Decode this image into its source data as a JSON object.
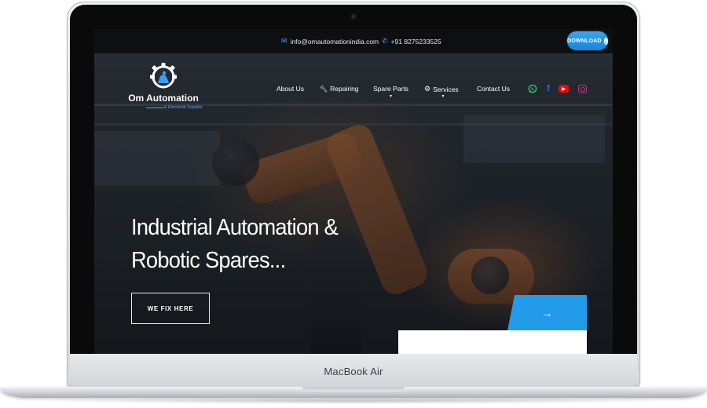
{
  "device": {
    "label": "MacBook Air"
  },
  "topbar": {
    "email": "info@omautomationindia.com",
    "phone": "+91 8275233525",
    "download_label": "DOWNLOAD"
  },
  "logo": {
    "name": "Om Automation",
    "tagline": "& Electrical Supplier"
  },
  "nav": {
    "items": [
      {
        "label": "About Us",
        "icon": ""
      },
      {
        "label": "Repairing",
        "icon": "wrench-icon"
      },
      {
        "label": "Spare Parts",
        "icon": ""
      },
      {
        "label": "Services",
        "icon": "gear-icon"
      },
      {
        "label": "Contact Us",
        "icon": ""
      }
    ]
  },
  "social": [
    "whatsapp-icon",
    "facebook-icon",
    "youtube-icon",
    "instagram-icon"
  ],
  "hero": {
    "line1": "Industrial Automation &",
    "line2": "Robotic Spares...",
    "cta_label": "WE FIX HERE",
    "arrow": "→"
  },
  "colors": {
    "accent": "#229bea",
    "topbar_bg": "#0d0f11"
  }
}
